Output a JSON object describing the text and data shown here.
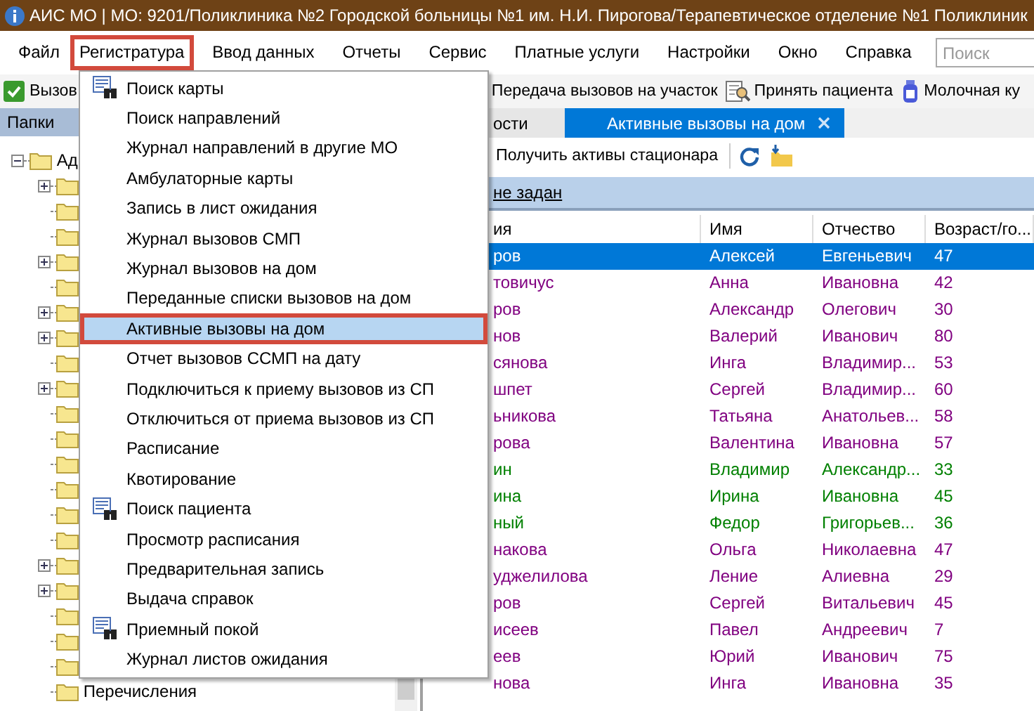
{
  "window": {
    "title": "АИС МО | МО: 9201/Поликлиника №2 Городской больницы №1 им. Н.И. Пирогова/Терапевтическое отделение №1 Поликлиник"
  },
  "menu_bar": {
    "items": [
      {
        "label": "Файл",
        "highlighted": false
      },
      {
        "label": "Регистратура",
        "highlighted": true
      },
      {
        "label": "Ввод данных",
        "highlighted": false
      },
      {
        "label": "Отчеты",
        "highlighted": false
      },
      {
        "label": "Сервис",
        "highlighted": false
      },
      {
        "label": "Платные услуги",
        "highlighted": false
      },
      {
        "label": "Настройки",
        "highlighted": false
      },
      {
        "label": "Окно",
        "highlighted": false
      },
      {
        "label": "Справка",
        "highlighted": false
      }
    ],
    "search": {
      "placeholder": "Поиск"
    }
  },
  "toolbar": {
    "buttons": [
      {
        "label": "Вызов"
      },
      {
        "label": "Передача вызовов на участок"
      },
      {
        "label": "Принять пациента"
      },
      {
        "label": "Молочная ку"
      }
    ]
  },
  "folders_panel": {
    "title": "Папки",
    "tree": [
      {
        "label": "Ад",
        "expanded": true,
        "children": [
          {
            "expandable": true
          },
          {
            "expandable": false
          },
          {
            "expandable": false
          },
          {
            "expandable": true
          },
          {
            "expandable": false
          },
          {
            "expandable": true
          },
          {
            "expandable": true
          },
          {
            "expandable": false
          },
          {
            "expandable": true
          },
          {
            "expandable": false
          },
          {
            "expandable": false
          },
          {
            "expandable": false
          },
          {
            "expandable": false
          },
          {
            "expandable": false
          },
          {
            "expandable": false
          },
          {
            "expandable": true
          },
          {
            "expandable": true
          },
          {
            "expandable": false
          },
          {
            "expandable": false
          },
          {
            "expandable": false
          },
          {
            "label": "Перечисления",
            "expandable": false
          }
        ]
      }
    ]
  },
  "dropdown_menu": {
    "items": [
      {
        "label": "Поиск карты",
        "has_icon": true,
        "selected": false,
        "highlighted": false
      },
      {
        "label": "Поиск направлений",
        "has_icon": false,
        "selected": false,
        "highlighted": false
      },
      {
        "label": "Журнал направлений в другие МО",
        "has_icon": false,
        "selected": false,
        "highlighted": false
      },
      {
        "label": "Амбулаторные карты",
        "has_icon": false,
        "selected": false,
        "highlighted": false
      },
      {
        "label": "Запись в лист ожидания",
        "has_icon": false,
        "selected": false,
        "highlighted": false
      },
      {
        "label": "Журнал вызовов СМП",
        "has_icon": false,
        "selected": false,
        "highlighted": false
      },
      {
        "label": "Журнал вызовов на дом",
        "has_icon": false,
        "selected": false,
        "highlighted": false
      },
      {
        "label": "Переданные списки вызовов на дом",
        "has_icon": false,
        "selected": false,
        "highlighted": false
      },
      {
        "label": "Активные вызовы на дом",
        "has_icon": false,
        "selected": true,
        "highlighted": true
      },
      {
        "label": "Отчет вызовов ССМП на дату",
        "has_icon": false,
        "selected": false,
        "highlighted": false
      },
      {
        "label": "Подключиться к приему вызовов из СП",
        "has_icon": false,
        "selected": false,
        "highlighted": false
      },
      {
        "label": "Отключиться от приема вызовов из СП",
        "has_icon": false,
        "selected": false,
        "highlighted": false
      },
      {
        "label": "Расписание",
        "has_icon": false,
        "selected": false,
        "highlighted": false
      },
      {
        "label": "Квотирование",
        "has_icon": false,
        "selected": false,
        "highlighted": false
      },
      {
        "label": "Поиск пациента",
        "has_icon": true,
        "selected": false,
        "highlighted": false
      },
      {
        "label": "Просмотр расписания",
        "has_icon": false,
        "selected": false,
        "highlighted": false
      },
      {
        "label": "Предварительная запись",
        "has_icon": false,
        "selected": false,
        "highlighted": false
      },
      {
        "label": "Выдача справок",
        "has_icon": false,
        "selected": false,
        "highlighted": false
      },
      {
        "label": "Приемный покой",
        "has_icon": true,
        "selected": false,
        "highlighted": false
      },
      {
        "label": "Журнал листов ожидания",
        "has_icon": false,
        "selected": false,
        "highlighted": false
      }
    ]
  },
  "workspace": {
    "tabs": [
      {
        "label": "ости",
        "selected": false,
        "closable": false
      },
      {
        "label": "Активные вызовы на дом",
        "selected": true,
        "closable": true
      }
    ],
    "toolbar": {
      "button": "Получить активы стационара"
    },
    "filter": {
      "link": "не задан"
    },
    "table": {
      "columns": [
        "ия",
        "Имя",
        "Отчество",
        "Возраст/го..."
      ],
      "rows": [
        {
          "cells": [
            "ров",
            "Алексей",
            "Евгеньевич",
            "47"
          ],
          "selected": true
        },
        {
          "cells": [
            "товичус",
            "Анна",
            "Ивановна",
            "42"
          ],
          "selected": false,
          "color": "#800080"
        },
        {
          "cells": [
            "ров",
            "Александр",
            "Олегович",
            "30"
          ],
          "selected": false,
          "color": "#800080"
        },
        {
          "cells": [
            "нов",
            "Валерий",
            "Иванович",
            "80"
          ],
          "selected": false,
          "color": "#800080"
        },
        {
          "cells": [
            "сянова",
            "Инга",
            "Владимир...",
            "53"
          ],
          "selected": false,
          "color": "#800080"
        },
        {
          "cells": [
            "шпет",
            "Сергей",
            "Владимир...",
            "60"
          ],
          "selected": false,
          "color": "#800080"
        },
        {
          "cells": [
            "ьникова",
            "Татьяна",
            "Анатольев...",
            "58"
          ],
          "selected": false,
          "color": "#800080"
        },
        {
          "cells": [
            "рова",
            "Валентина",
            "Ивановна",
            "57"
          ],
          "selected": false,
          "color": "#800080"
        },
        {
          "cells": [
            "ин",
            "Владимир",
            "Александр...",
            "33"
          ],
          "selected": false,
          "color": "#008000"
        },
        {
          "cells": [
            "ина",
            "Ирина",
            "Ивановна",
            "45"
          ],
          "selected": false,
          "color": "#008000"
        },
        {
          "cells": [
            "ный",
            "Федор",
            "Григорьев...",
            "36"
          ],
          "selected": false,
          "color": "#008000"
        },
        {
          "cells": [
            "накова",
            "Ольга",
            "Николаевна",
            "47"
          ],
          "selected": false,
          "color": "#800080"
        },
        {
          "cells": [
            "уджелилова",
            "Ление",
            "Алиевна",
            "29"
          ],
          "selected": false,
          "color": "#800080"
        },
        {
          "cells": [
            "ров",
            "Сергей",
            "Витальевич",
            "45"
          ],
          "selected": false,
          "color": "#800080"
        },
        {
          "cells": [
            "исеев",
            "Павел",
            "Андреевич",
            "7"
          ],
          "selected": false,
          "color": "#800080"
        },
        {
          "cells": [
            "еев",
            "Юрий",
            "Иванович",
            "75"
          ],
          "selected": false,
          "color": "#800080"
        },
        {
          "cells": [
            "нова",
            "Инга",
            "Ивановна",
            "35"
          ],
          "selected": false,
          "color": "#800080"
        }
      ]
    }
  }
}
